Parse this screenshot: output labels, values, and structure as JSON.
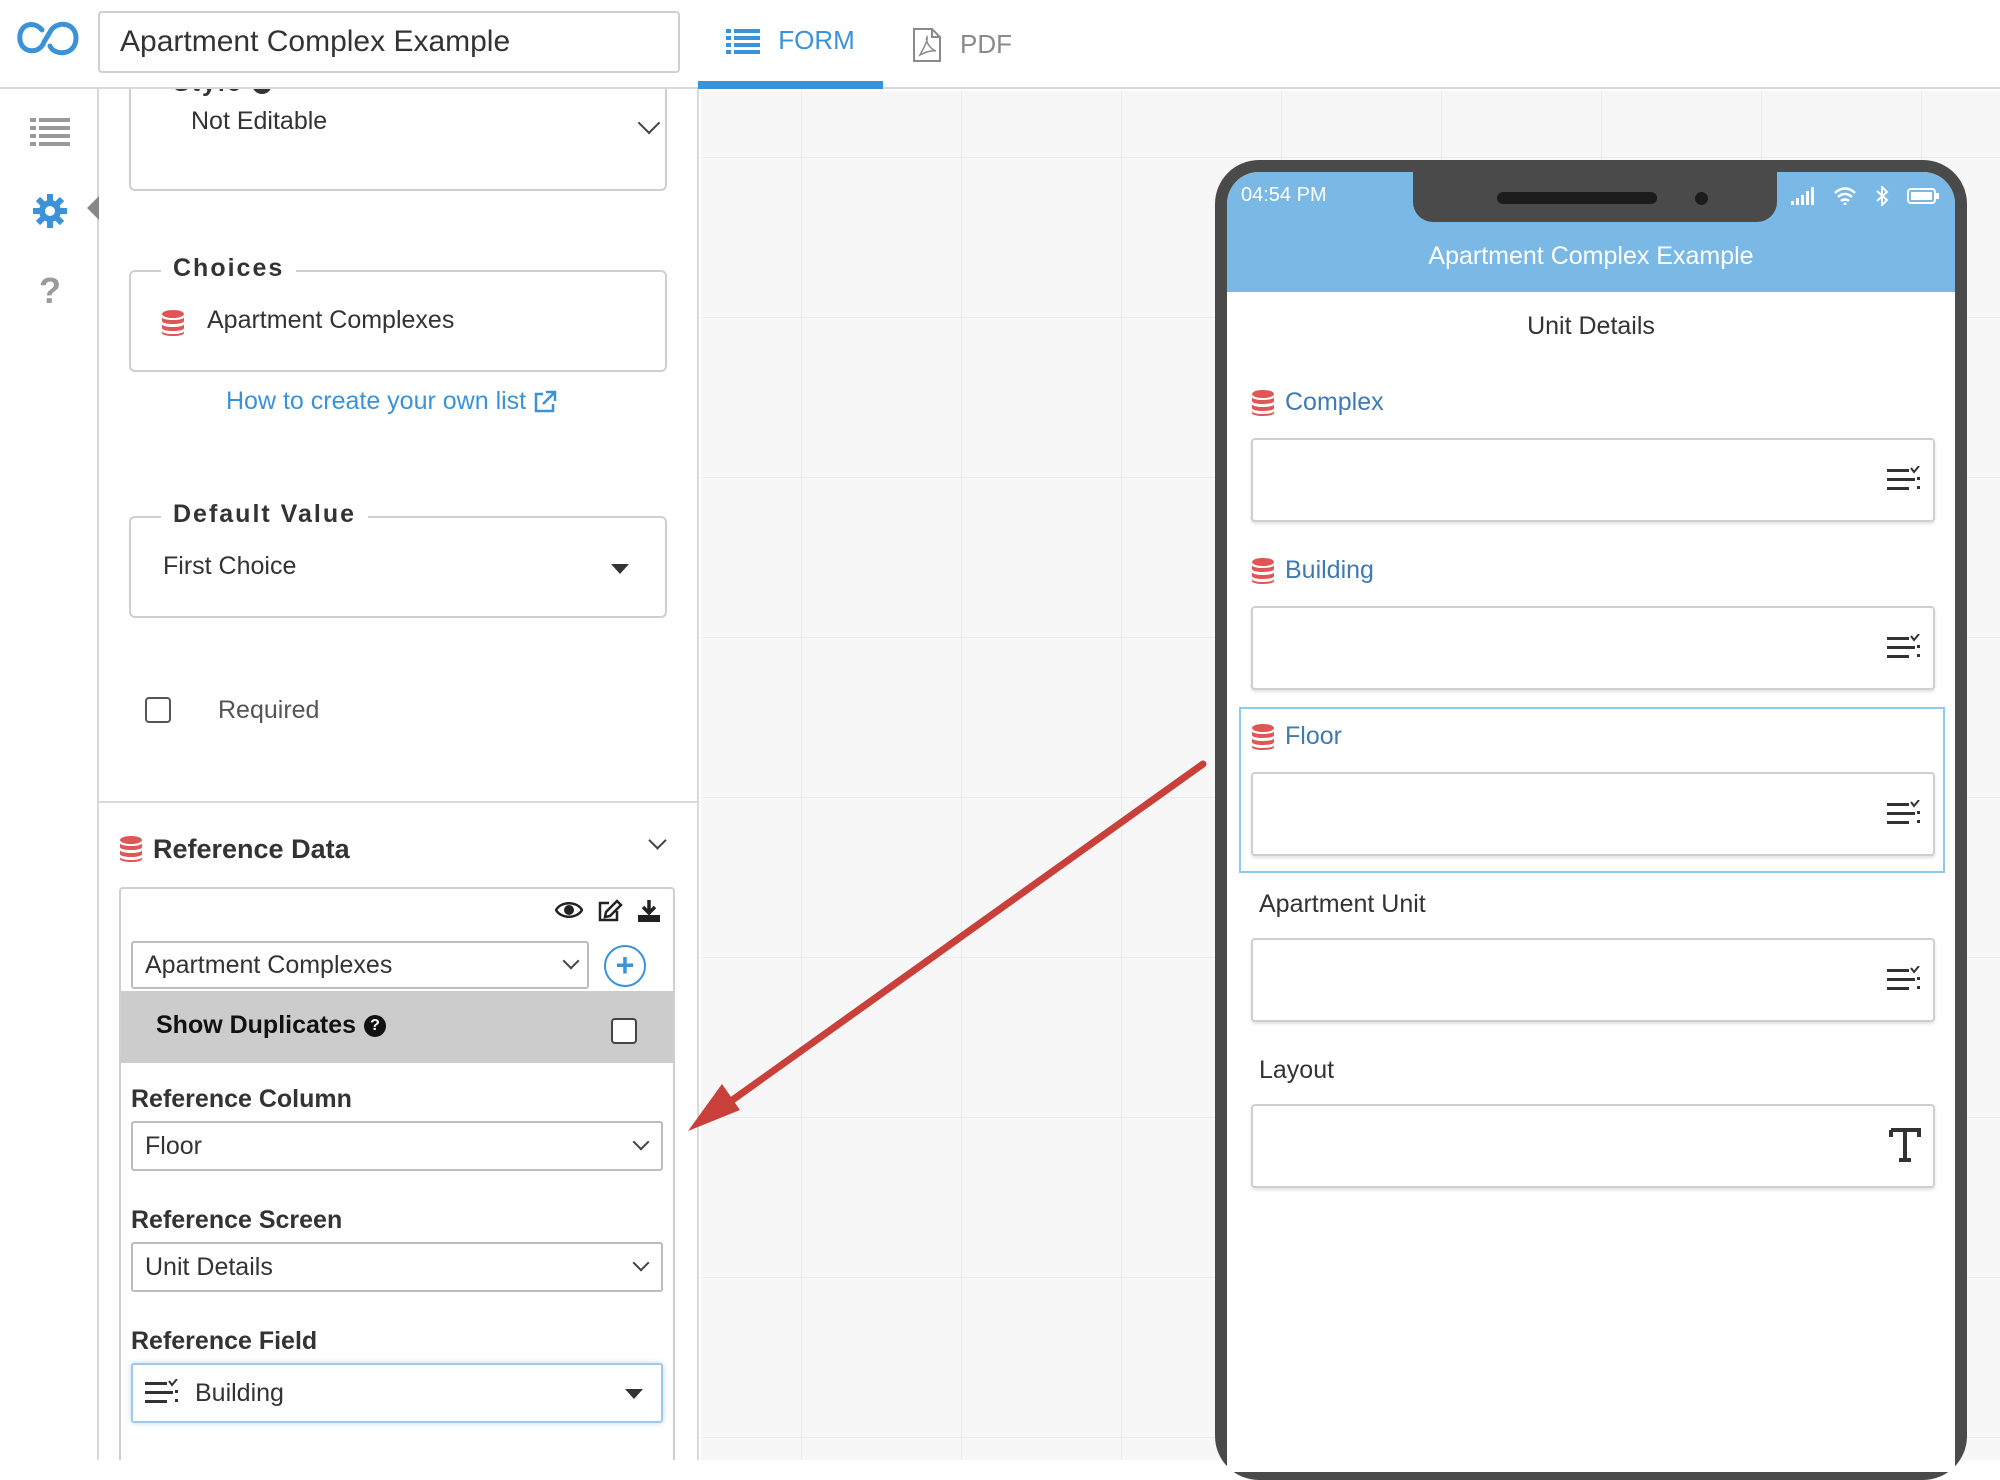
{
  "app": {
    "form_title": "Apartment Complex Example"
  },
  "tabs": [
    {
      "label": "FORM",
      "active": true,
      "icon": "list-icon"
    },
    {
      "label": "PDF",
      "active": false,
      "icon": "pdf-icon"
    }
  ],
  "rail": {
    "icons": [
      "fields-list-icon",
      "settings-gear-icon",
      "help-question-icon"
    ]
  },
  "settings": {
    "style": {
      "label": "Style",
      "value": "Not Editable"
    },
    "choices": {
      "label": "Choices",
      "value": "Apartment Complexes"
    },
    "help_link": "How to create your own list",
    "default_value": {
      "label": "Default Value",
      "value": "First Choice"
    },
    "required_label": "Required",
    "required_checked": false
  },
  "reference_data": {
    "title": "Reference Data",
    "source_value": "Apartment Complexes",
    "show_duplicates_label": "Show Duplicates",
    "show_duplicates_checked": false,
    "column_label": "Reference Column",
    "column_value": "Floor",
    "screen_label": "Reference Screen",
    "screen_value": "Unit Details",
    "field_label": "Reference Field",
    "field_value": "Building"
  },
  "phone": {
    "time": "04:54 PM",
    "app_title": "Apartment Complex Example",
    "section_title": "Unit Details",
    "fields": [
      {
        "label": "Complex",
        "icon": "choice-list-icon"
      },
      {
        "label": "Building",
        "icon": "choice-list-icon"
      },
      {
        "label": "Floor",
        "icon": "choice-list-icon"
      },
      {
        "label": "Apartment Unit",
        "icon": "choice-list-icon"
      },
      {
        "label": "Layout",
        "icon": "text-icon"
      }
    ]
  },
  "colors": {
    "accent": "#3a93d8",
    "phone_header": "#7ab8e5",
    "database_icon": "#e05656",
    "arrow": "#c9403a"
  }
}
